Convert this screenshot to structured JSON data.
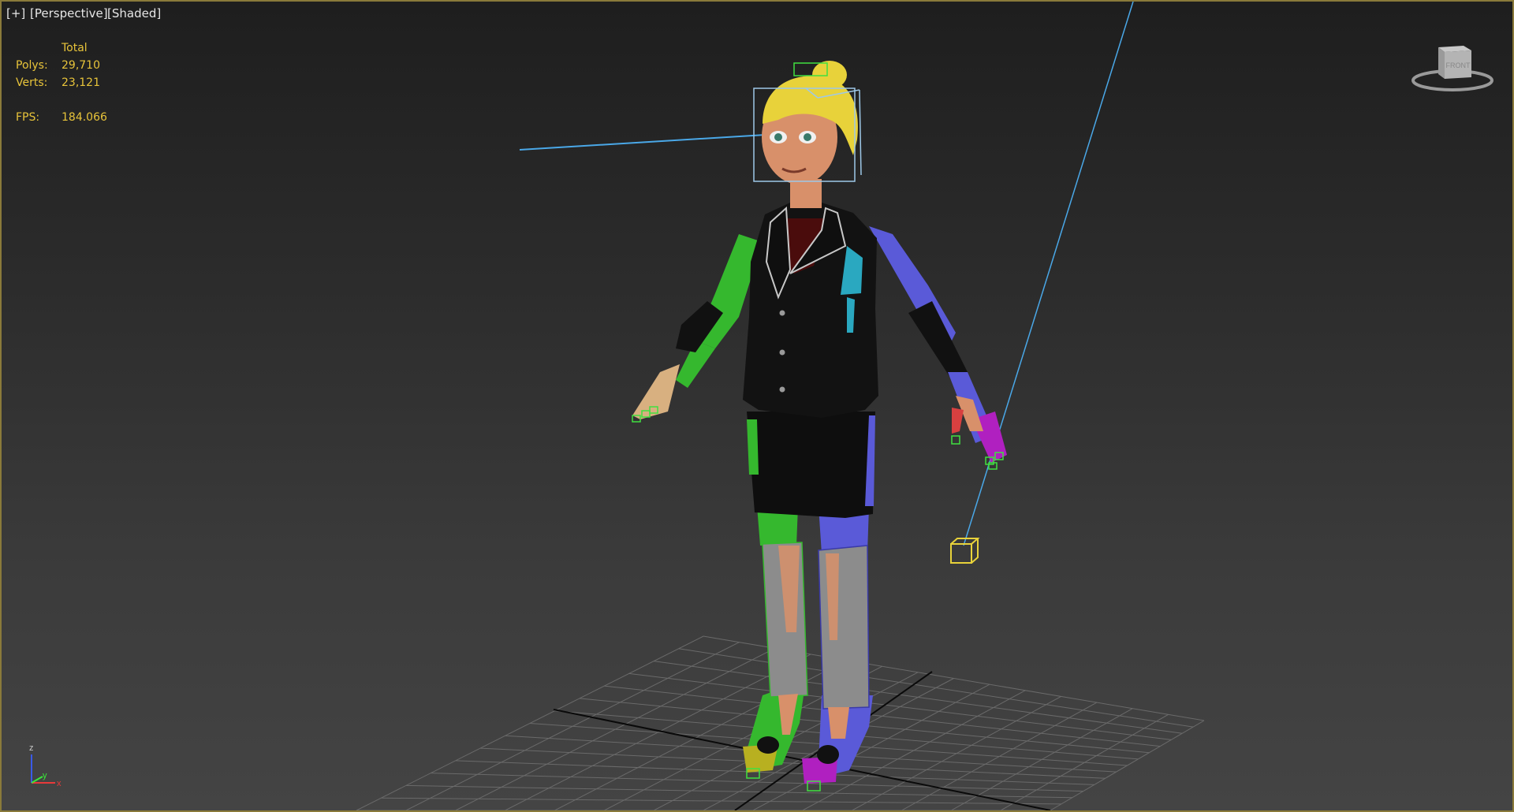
{
  "viewport": {
    "menu_label": "[+]",
    "view_label": "[Perspective]",
    "shading_label": "[Shaded]",
    "border_color": "#8a7a3a",
    "background_top": "#1e1e1e",
    "background_bottom": "#444444"
  },
  "stats": {
    "header": "Total",
    "polys_label": "Polys:",
    "polys_value": "29,710",
    "verts_label": "Verts:",
    "verts_value": "23,121",
    "fps_label": "FPS:",
    "fps_value": "184.066",
    "color": "#e8c43a"
  },
  "viewcube": {
    "face_text": "FRONT",
    "icon": "viewcube-icon"
  },
  "axis_tripod": {
    "z_label": "z",
    "y_label": "y",
    "x_label": "x"
  },
  "scene": {
    "character": "female-character-rig",
    "grid": "ground-grid",
    "look_at_target": "yellow-point-helper",
    "colors": {
      "left_limb": "#35b82e",
      "right_limb": "#5a5ad8",
      "suit": "#111111",
      "hair": "#e8d23a",
      "skin": "#d8906a",
      "calf": "#8c8c8c",
      "target_line": "#4aa8e8",
      "selection_box": "#9ec8e8",
      "bone_helper": "#40e040"
    }
  }
}
